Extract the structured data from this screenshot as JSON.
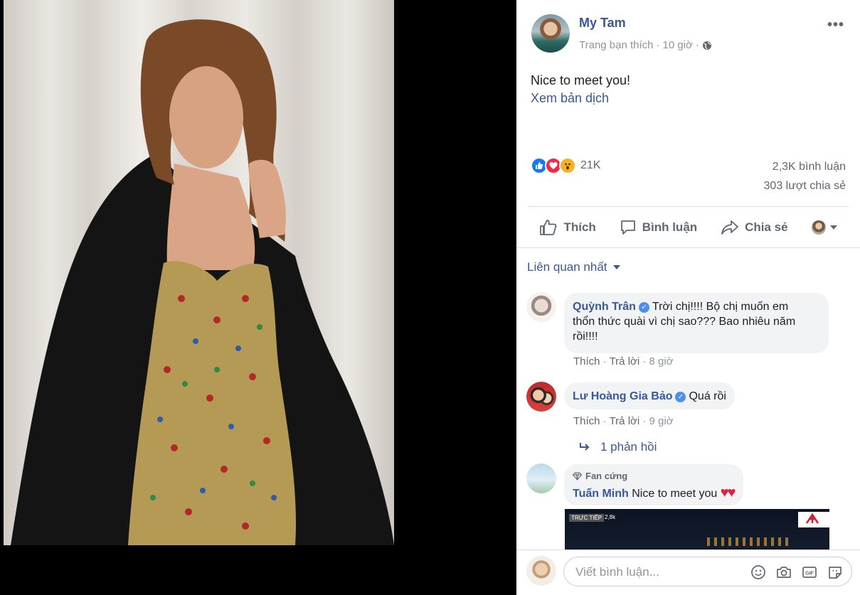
{
  "post": {
    "author": "My Tam",
    "audience": "Trang bạn thích",
    "time": "10 giờ",
    "more": "•••",
    "text": "Nice to meet you!",
    "translate": "Xem bản dịch",
    "reaction_count": "21K",
    "comment_count": "2,3K bình luận",
    "share_count": "303 lượt chia sẻ"
  },
  "actions": {
    "like": "Thích",
    "comment": "Bình luận",
    "share": "Chia sẻ"
  },
  "sort": "Liên quan nhất",
  "comments": [
    {
      "name": "Quỳnh Trân",
      "line1": "Trời chị!!!! Bộ chị muốn em",
      "line2": "thổn thức quài vì chị sao??? Bao nhiêu năm",
      "line3": "rồi!!!!",
      "like": "Thích",
      "reply": "Trả lời",
      "time": "8 giờ"
    },
    {
      "name": "Lư Hoàng Gia Bảo",
      "text": "Quá rồi",
      "like": "Thích",
      "reply": "Trả lời",
      "time": "9 giờ",
      "replies": "1 phản hồi"
    },
    {
      "badge": "Fan cứng",
      "name": "Tuấn Minh",
      "text": "Nice to meet you"
    }
  ],
  "video": {
    "live": "TRỰC TIẾP",
    "views": "2,8k"
  },
  "composer": {
    "placeholder": "Viết bình luận..."
  }
}
